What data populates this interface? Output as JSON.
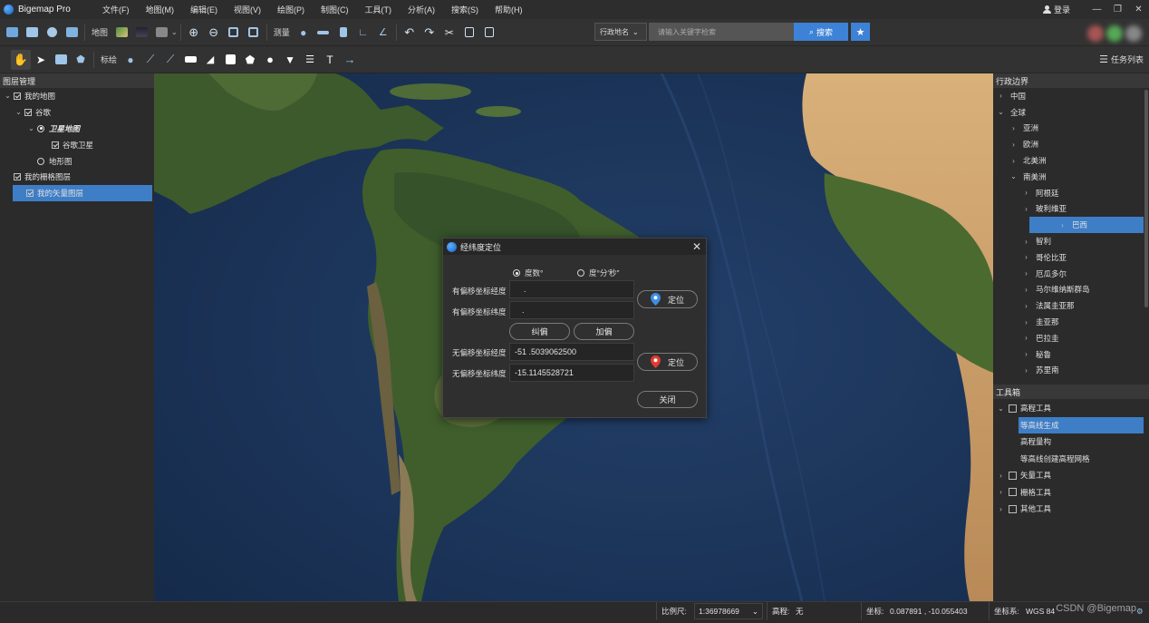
{
  "app": {
    "title": "Bigemap Pro",
    "menu": [
      "文件(F)",
      "地图(M)",
      "编辑(E)",
      "视图(V)",
      "绘图(P)",
      "制图(C)",
      "工具(T)",
      "分析(A)",
      "搜索(S)",
      "帮助(H)"
    ],
    "login_label": "登录",
    "window_controls": [
      "—",
      "❐",
      "✕"
    ]
  },
  "toolbar1": {
    "map_label": "地图",
    "measure_label": "测量",
    "region_select": "行政地名",
    "search_placeholder": "请输入关键字检索",
    "search_button": "搜索"
  },
  "toolbar2": {
    "annotate_label": "标绘",
    "task_list_label": "任务列表"
  },
  "layer_panel": {
    "title": "图层管理",
    "items": [
      {
        "label": "我的地图",
        "level": 0,
        "type": "checkbox",
        "checked": true,
        "expanded": true
      },
      {
        "label": "谷歌",
        "level": 1,
        "type": "checkbox",
        "checked": true,
        "expanded": true
      },
      {
        "label": "卫星地图",
        "level": 2,
        "type": "radio",
        "checked": true,
        "expanded": true
      },
      {
        "label": "谷歌卫星",
        "level": 3,
        "type": "checkbox",
        "checked": true
      },
      {
        "label": "地形图",
        "level": 2,
        "type": "radio",
        "checked": false
      },
      {
        "label": "我的栅格图层",
        "level": 0,
        "type": "checkbox",
        "checked": true
      },
      {
        "label": "我的矢量图层",
        "level": 0,
        "type": "checkbox",
        "checked": true,
        "selected": true
      }
    ]
  },
  "admin_panel": {
    "title": "行政边界",
    "items": [
      {
        "label": "中国",
        "level": 0,
        "expanded": false
      },
      {
        "label": "全球",
        "level": 0,
        "expanded": true
      },
      {
        "label": "亚洲",
        "level": 1,
        "expanded": false
      },
      {
        "label": "欧洲",
        "level": 1,
        "expanded": false
      },
      {
        "label": "北美洲",
        "level": 1,
        "expanded": false
      },
      {
        "label": "南美洲",
        "level": 1,
        "expanded": true
      },
      {
        "label": "阿根廷",
        "level": 2,
        "expanded": false
      },
      {
        "label": "玻利维亚",
        "level": 2,
        "expanded": false
      },
      {
        "label": "巴西",
        "level": 2,
        "expanded": false,
        "selected": true
      },
      {
        "label": "智利",
        "level": 2,
        "expanded": false
      },
      {
        "label": "哥伦比亚",
        "level": 2,
        "expanded": false
      },
      {
        "label": "厄瓜多尔",
        "level": 2,
        "expanded": false
      },
      {
        "label": "马尔维纳斯群岛",
        "level": 2,
        "expanded": false
      },
      {
        "label": "法属圭亚那",
        "level": 2,
        "expanded": false
      },
      {
        "label": "圭亚那",
        "level": 2,
        "expanded": false
      },
      {
        "label": "巴拉圭",
        "level": 2,
        "expanded": false
      },
      {
        "label": "秘鲁",
        "level": 2,
        "expanded": false
      },
      {
        "label": "苏里南",
        "level": 2,
        "expanded": false
      }
    ]
  },
  "toolbox": {
    "title": "工具箱",
    "items": [
      {
        "label": "高程工具",
        "level": 0,
        "expanded": true,
        "icon": "elevation-tool-icon"
      },
      {
        "label": "等高线生成",
        "level": 1,
        "selected": true
      },
      {
        "label": "高程量构",
        "level": 1
      },
      {
        "label": "等高线创建高程网格",
        "level": 1
      },
      {
        "label": "矢量工具",
        "level": 0,
        "expanded": false,
        "icon": "vector-tool-icon"
      },
      {
        "label": "栅格工具",
        "level": 0,
        "expanded": false,
        "icon": "raster-tool-icon"
      },
      {
        "label": "其他工具",
        "level": 0,
        "expanded": false,
        "icon": "other-tool-icon"
      }
    ]
  },
  "dialog": {
    "title": "经纬度定位",
    "radio_decimal": "度数°",
    "radio_dms": "度°分′秒″",
    "offset_lon_label": "有偏移坐标经度",
    "offset_lat_label": "有偏移坐标纬度",
    "offset_lon_value": ".",
    "offset_lat_value": ".",
    "correct_button": "纠偏",
    "add_offset_button": "加偏",
    "locate_button_1": "定位",
    "plain_lon_label": "无偏移坐标经度",
    "plain_lat_label": "无偏移坐标纬度",
    "plain_lon_value": "-51 .5039062500",
    "plain_lat_value": "-15.1145528721",
    "locate_button_2": "定位",
    "close_button": "关闭"
  },
  "statusbar": {
    "scale_label": "比例尺:",
    "scale_value": "1:36978669",
    "elevation_label": "高程:",
    "elevation_value": "无",
    "coord_label": "坐标:",
    "coord_value": "0.087891 , -10.055403",
    "crs_label": "坐标系:",
    "crs_value": "WGS 84",
    "watermark": "CSDN @Bigemap"
  },
  "colors": {
    "accent": "#3d82d6",
    "selection": "#3e7ec7",
    "panel_bg": "#2b2b2b",
    "ocean": "#1d3356",
    "land": "#3e5a2a",
    "desert": "#b99365"
  }
}
